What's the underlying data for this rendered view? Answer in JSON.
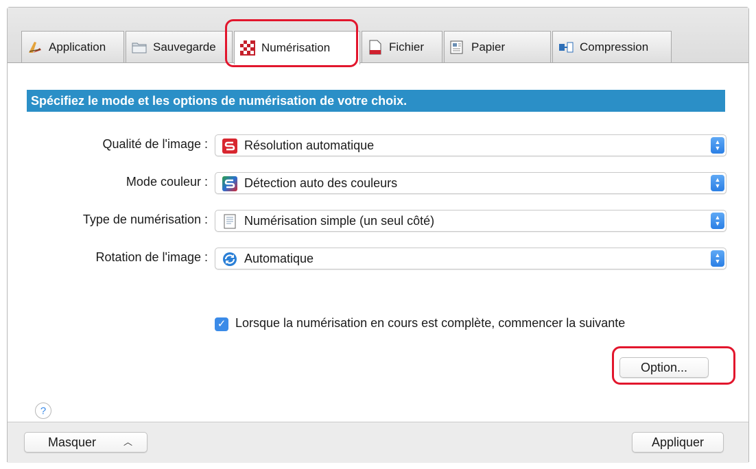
{
  "tabs": [
    {
      "label": "Application",
      "icon": "application-pen-icon",
      "active": false
    },
    {
      "label": "Sauvegarde",
      "icon": "folder-icon",
      "active": false
    },
    {
      "label": "Numérisation",
      "icon": "scan-checker-icon",
      "active": true
    },
    {
      "label": "Fichier",
      "icon": "pdf-file-icon",
      "active": false
    },
    {
      "label": "Papier",
      "icon": "paper-icon",
      "active": false
    },
    {
      "label": "Compression",
      "icon": "compression-icon",
      "active": false
    }
  ],
  "banner": "Spécifiez le mode et les options de numérisation de votre choix.",
  "settings": [
    {
      "label": "Qualité de l'image :",
      "value": "Résolution automatique",
      "icon": "scansnap-red-icon"
    },
    {
      "label": "Mode couleur :",
      "value": "Détection auto des couleurs",
      "icon": "scansnap-color-icon"
    },
    {
      "label": "Type de numérisation :",
      "value": "Numérisation simple (un seul côté)",
      "icon": "single-page-icon"
    },
    {
      "label": "Rotation de l'image :",
      "value": "Automatique",
      "icon": "rotate-icon"
    }
  ],
  "continue_scan": {
    "checked": true,
    "label": "Lorsque la numérisation en cours est complète, commencer la suivante"
  },
  "option_button": "Option...",
  "help_label": "?",
  "footer": {
    "hide_button": "Masquer",
    "apply_button": "Appliquer"
  },
  "colors": {
    "banner": "#2b8fc7",
    "highlight": "#e2162d",
    "accent": "#3b8be8"
  }
}
